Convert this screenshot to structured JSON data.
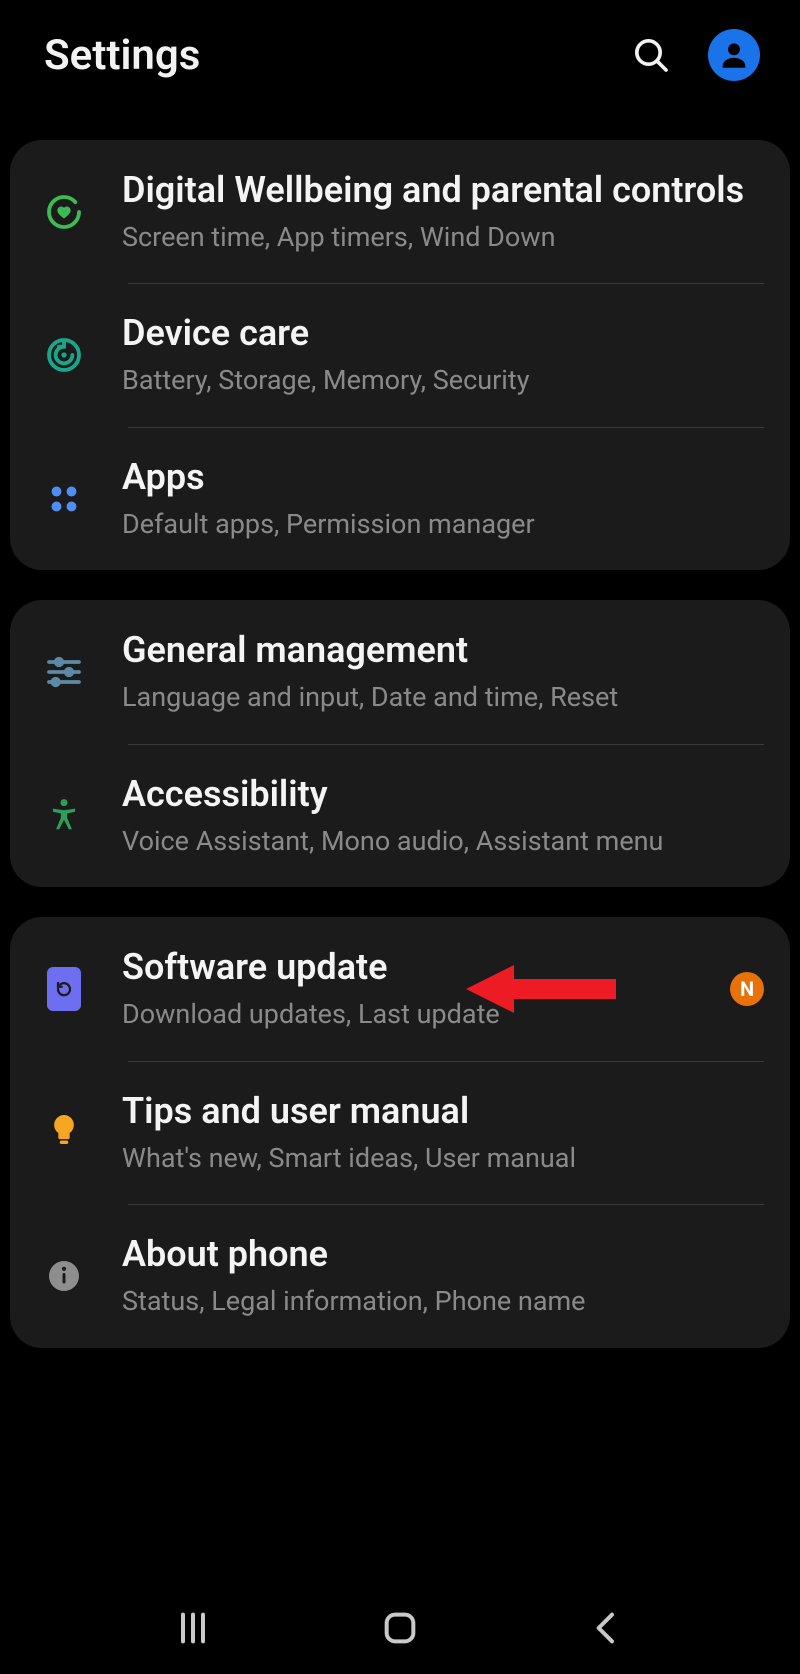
{
  "header": {
    "title": "Settings"
  },
  "groups": [
    {
      "items": [
        {
          "key": "wellbeing",
          "title": "Digital Wellbeing and parental controls",
          "sub": "Screen time, App timers, Wind Down"
        },
        {
          "key": "devicecare",
          "title": "Device care",
          "sub": "Battery, Storage, Memory, Security"
        },
        {
          "key": "apps",
          "title": "Apps",
          "sub": "Default apps, Permission manager"
        }
      ]
    },
    {
      "items": [
        {
          "key": "general",
          "title": "General management",
          "sub": "Language and input, Date and time, Reset"
        },
        {
          "key": "accessibility",
          "title": "Accessibility",
          "sub": "Voice Assistant, Mono audio, Assistant menu"
        }
      ]
    },
    {
      "items": [
        {
          "key": "software",
          "title": "Software update",
          "sub": "Download updates, Last update",
          "badge": "N",
          "arrow": true
        },
        {
          "key": "tips",
          "title": "Tips and user manual",
          "sub": "What's new, Smart ideas, User manual"
        },
        {
          "key": "about",
          "title": "About phone",
          "sub": "Status, Legal information, Phone name"
        }
      ]
    }
  ]
}
